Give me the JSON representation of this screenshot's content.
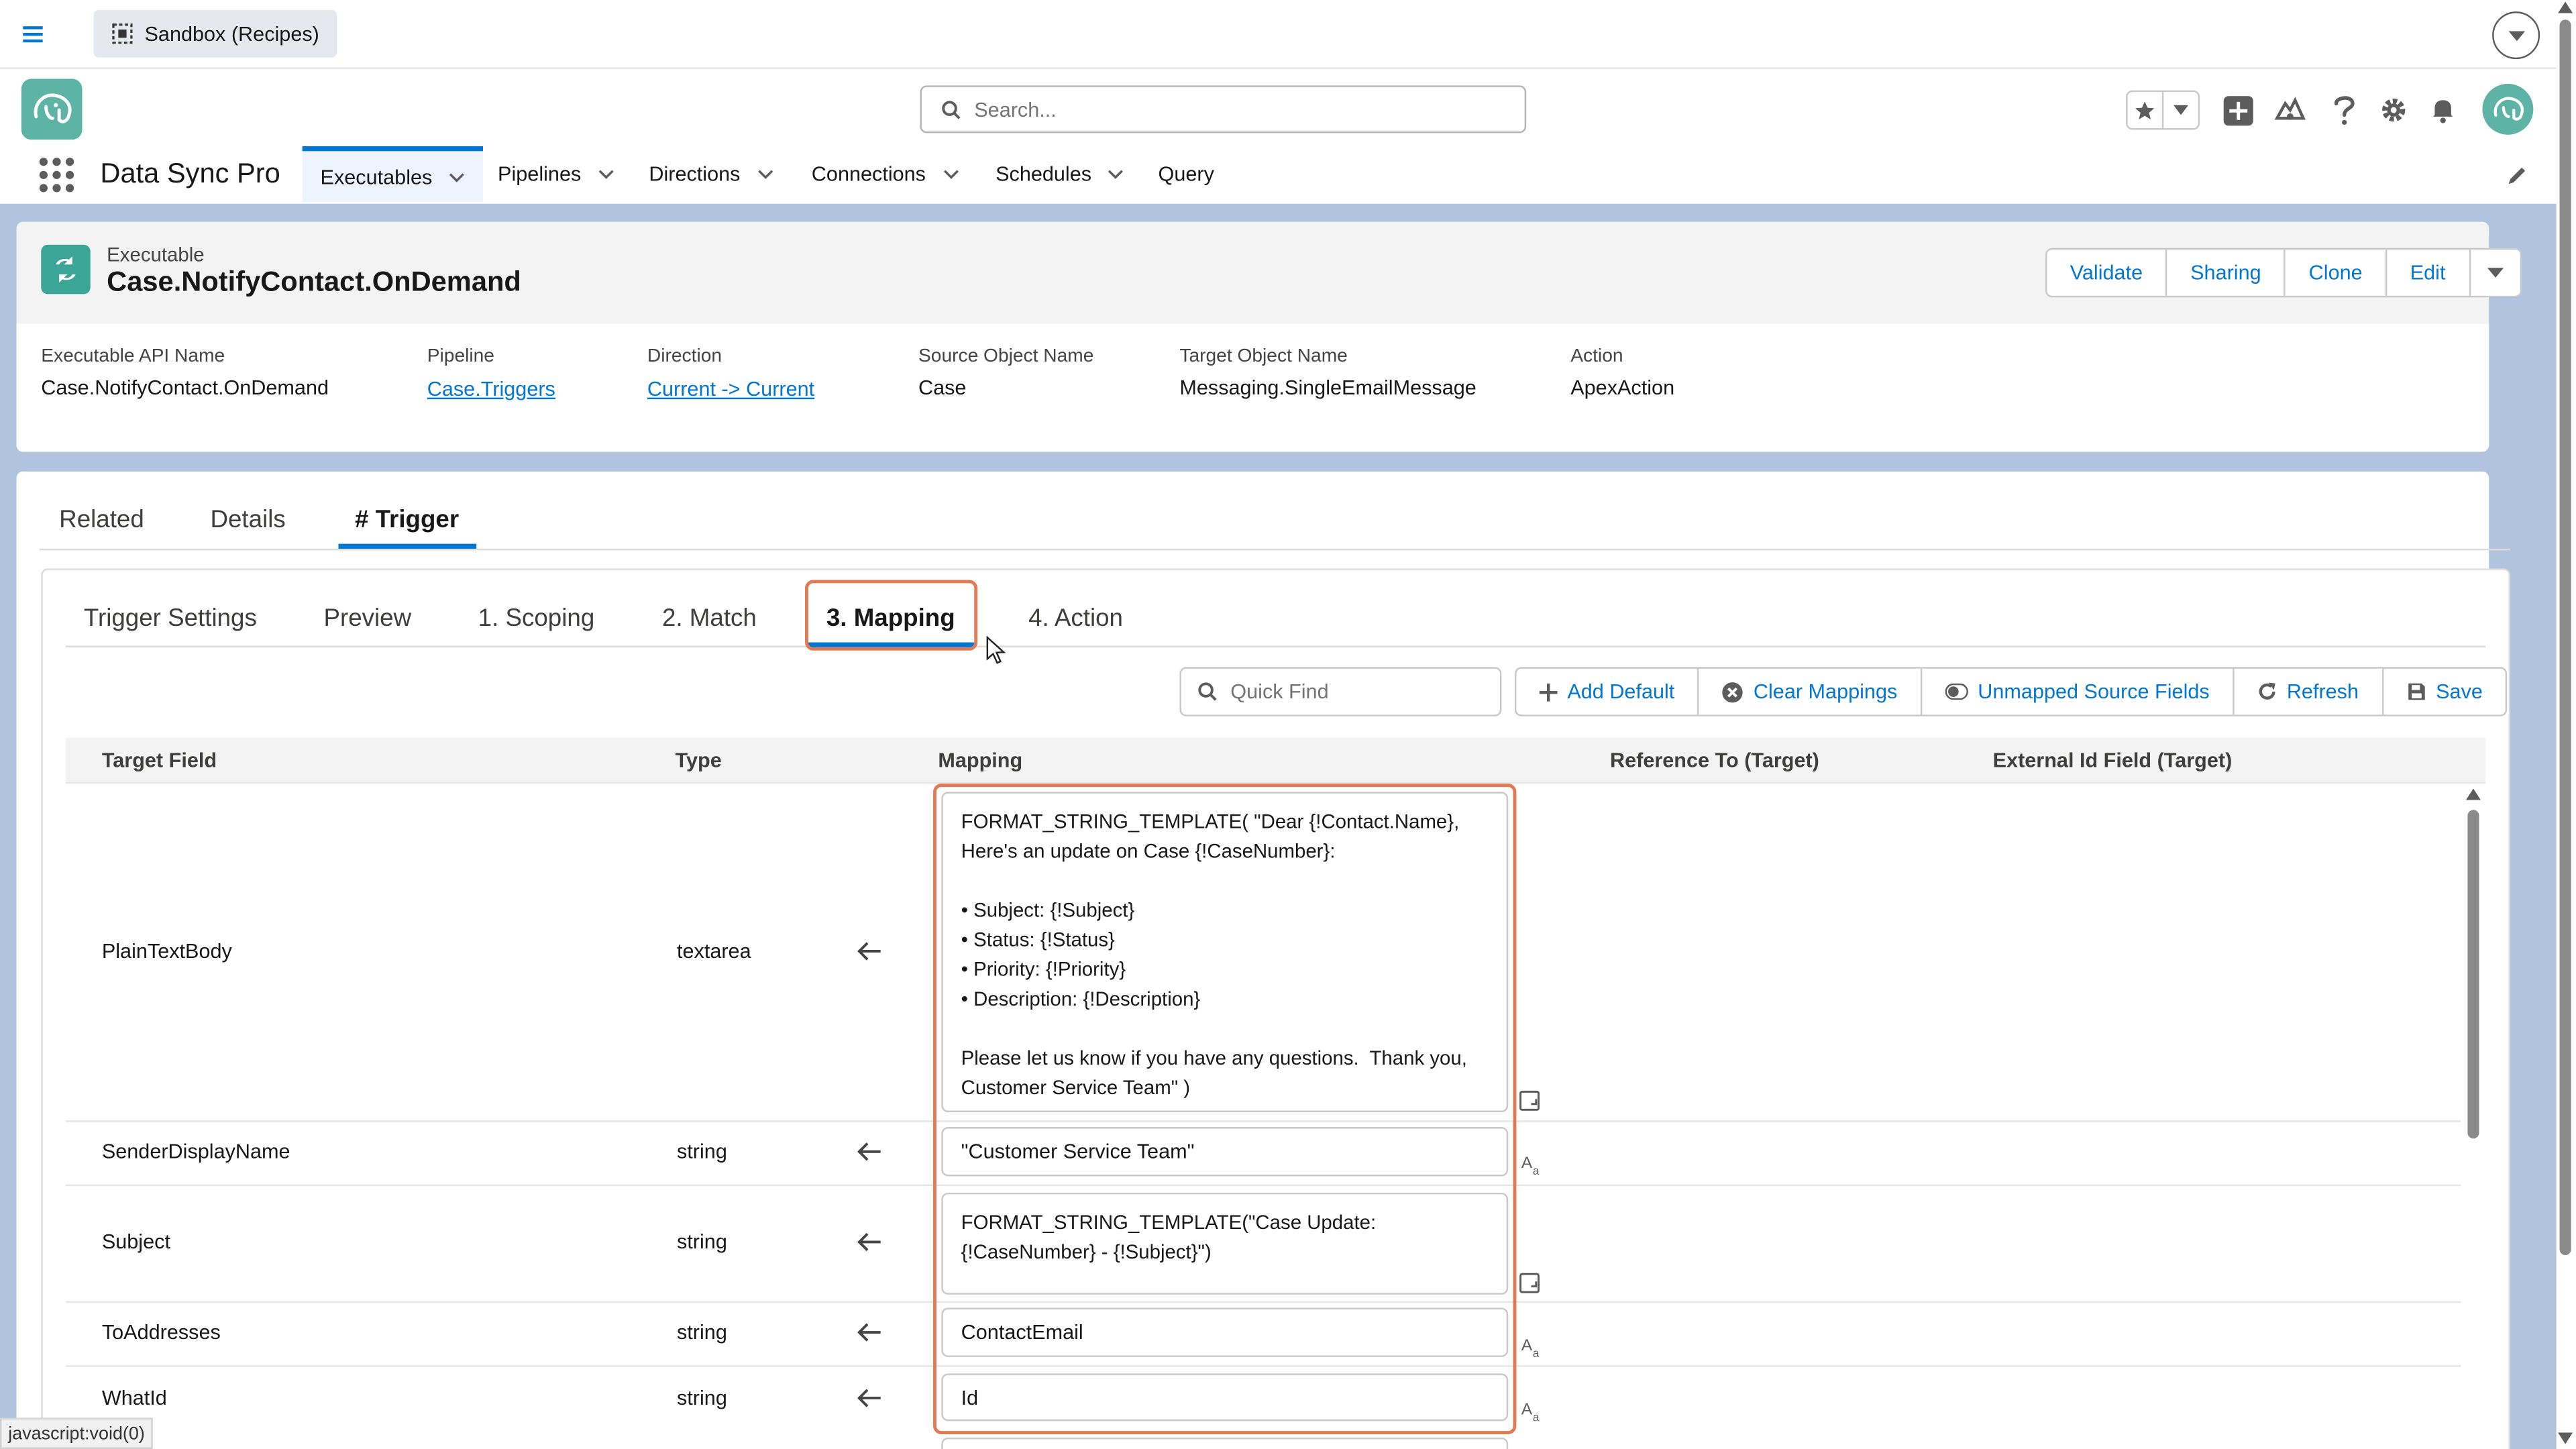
{
  "topbar": {
    "org_label": "Sandbox (Recipes)"
  },
  "header": {
    "search_placeholder": "Search..."
  },
  "nav": {
    "app_name": "Data Sync Pro",
    "tabs": [
      {
        "label": "Executables",
        "active": true
      },
      {
        "label": "Pipelines"
      },
      {
        "label": "Directions"
      },
      {
        "label": "Connections"
      },
      {
        "label": "Schedules"
      },
      {
        "label": "Query"
      }
    ]
  },
  "record": {
    "type": "Executable",
    "title": "Case.NotifyContact.OnDemand",
    "buttons": [
      "Validate",
      "Sharing",
      "Clone",
      "Edit"
    ],
    "fields": [
      {
        "label": "Executable API Name",
        "value": "Case.NotifyContact.OnDemand"
      },
      {
        "label": "Pipeline",
        "value": "Case.Triggers"
      },
      {
        "label": "Direction",
        "value": "Current -> Current"
      },
      {
        "label": "Source Object Name",
        "value": "Case"
      },
      {
        "label": "Target Object Name",
        "value": "Messaging.SingleEmailMessage"
      },
      {
        "label": "Action",
        "value": "ApexAction"
      }
    ]
  },
  "tabs": [
    "Related",
    "Details",
    "# Trigger"
  ],
  "subtabs": [
    "Trigger Settings",
    "Preview",
    "1. Scoping",
    "2. Match",
    "3. Mapping",
    "4. Action"
  ],
  "toolbar": {
    "quickfind_placeholder": "Quick Find",
    "buttons": [
      "Add Default",
      "Clear Mappings",
      "Unmapped Source Fields",
      "Refresh",
      "Save"
    ]
  },
  "table": {
    "headers": [
      "Target Field",
      "Type",
      "Mapping",
      "Reference To (Target)",
      "External Id Field (Target)"
    ],
    "rows": [
      {
        "field": "PlainTextBody",
        "type": "textarea",
        "mapping": "FORMAT_STRING_TEMPLATE( \"Dear {!Contact.Name},  Here's an update on Case {!CaseNumber}:\n\n• Subject: {!Subject}\n• Status: {!Status}\n• Priority: {!Priority}\n• Description: {!Description}\n\nPlease let us know if you have any questions.  Thank you, Customer Service Team\" )"
      },
      {
        "field": "SenderDisplayName",
        "type": "string",
        "mapping": "\"Customer Service Team\""
      },
      {
        "field": "Subject",
        "type": "string",
        "mapping": "FORMAT_STRING_TEMPLATE(\"Case Update: {!CaseNumber} - {!Subject}\")"
      },
      {
        "field": "ToAddresses",
        "type": "string",
        "mapping": "ContactEmail"
      },
      {
        "field": "WhatId",
        "type": "string",
        "mapping": "Id"
      }
    ]
  },
  "statusbar": "javascript:void(0)",
  "colors": {
    "accent": "#0176d3",
    "highlight": "#e07b53",
    "page_bg": "#b0c4df"
  }
}
